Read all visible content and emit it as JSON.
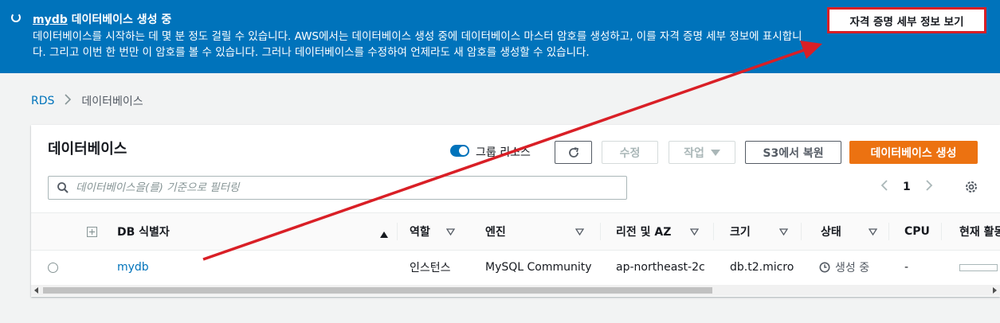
{
  "banner": {
    "db_name": "mydb",
    "title_rest": "데이터베이스 생성 중",
    "body": "데이터베이스를 시작하는 데 몇 분 정도 걸릴 수 있습니다. AWS에서는 데이터베이스 생성 중에 데이터베이스 마스터 암호를 생성하고, 이를 자격 증명 세부 정보에 표시합니다. 그리고 이번 한 번만 이 암호를 볼 수 있습니다. 그러나 데이터베이스를 수정하여 언제라도 새 암호를 생성할 수 있습니다.",
    "button": "자격 증명 세부 정보 보기"
  },
  "breadcrumb": {
    "root": "RDS",
    "current": "데이터베이스"
  },
  "panel": {
    "title": "데이터베이스",
    "group_toggle_label": "그룹 리소스",
    "modify": "수정",
    "actions": "작업",
    "restore_s3": "S3에서 복원",
    "create": "데이터베이스 생성",
    "search_placeholder": "데이터베이스을(를) 기준으로 필터링",
    "page": "1"
  },
  "table": {
    "headers": {
      "id": "DB 식별자",
      "role": "역할",
      "engine": "엔진",
      "region": "리전 및 AZ",
      "size": "크기",
      "status": "상태",
      "cpu": "CPU",
      "activity": "현재 활동"
    },
    "rows": [
      {
        "id": "mydb",
        "role": "인스턴스",
        "engine": "MySQL Community",
        "region": "ap-northeast-2c",
        "size": "db.t2.micro",
        "status": "생성 중",
        "cpu": "-"
      }
    ]
  },
  "colors": {
    "banner_bg": "#0073bb",
    "primary": "#ec7211",
    "link": "#0073bb",
    "annotation": "#d91f26"
  }
}
